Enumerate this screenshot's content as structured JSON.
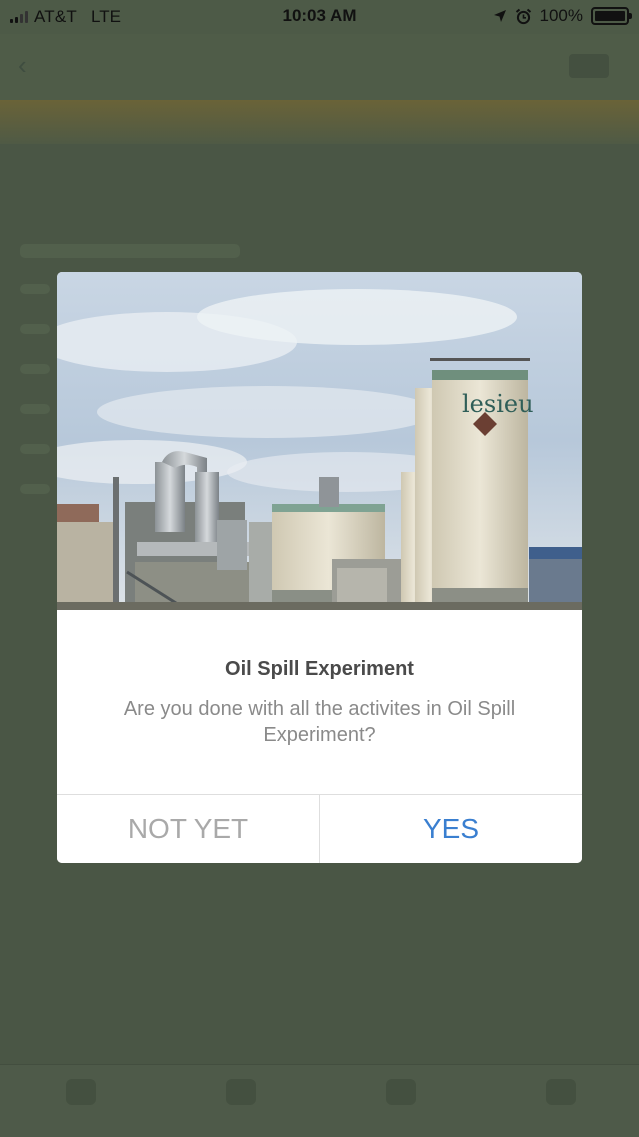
{
  "status_bar": {
    "carrier": "AT&T",
    "network": "LTE",
    "time": "10:03 AM",
    "battery": "100%",
    "icons": [
      "signal-icon",
      "location-icon",
      "alarm-icon",
      "battery-icon"
    ]
  },
  "dialog": {
    "title": "Oil Spill Experiment",
    "message": "Are you done with all the activites in Oil Spill Experiment?",
    "no_label": "NOT YET",
    "yes_label": "YES",
    "image_text": "lesieu",
    "colors": {
      "yes": "#3a7fd0",
      "no": "#a9a9a9",
      "title": "#4a4a4a",
      "message": "#8a8a8a"
    }
  },
  "overlay": {
    "color": "#4b5746"
  }
}
